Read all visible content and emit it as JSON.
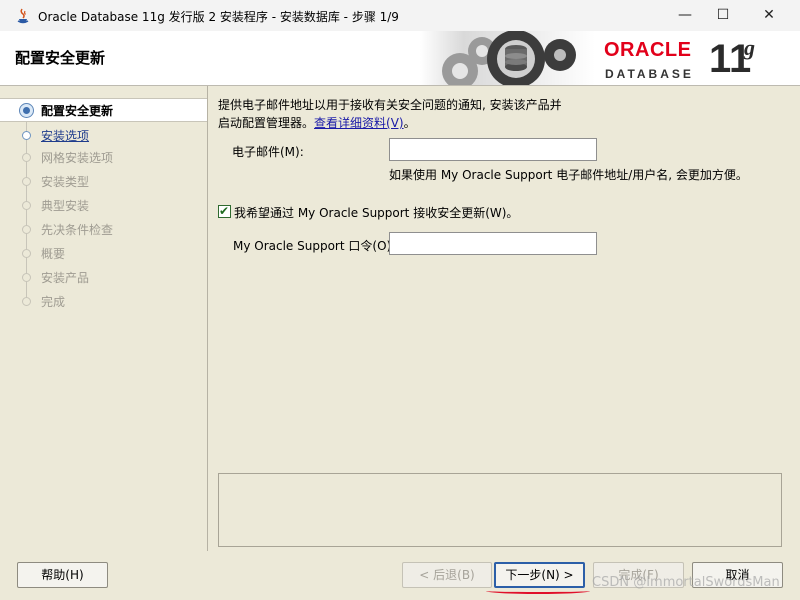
{
  "window": {
    "title": "Oracle Database 11g 发行版 2 安装程序 - 安装数据库 - 步骤 1/9",
    "controls": {
      "minimize": "—",
      "maximize": "☐",
      "close": "✕"
    }
  },
  "header": {
    "title": "配置安全更新",
    "brand": {
      "oracle": "ORACLE",
      "database": "DATABASE",
      "version": "11",
      "version_suffix": "g",
      "brand_color": "#e2001a"
    }
  },
  "sidebar": {
    "steps": [
      {
        "label": "配置安全更新",
        "state": "current"
      },
      {
        "label": "安装选项",
        "state": "link"
      },
      {
        "label": "网格安装选项",
        "state": "disabled"
      },
      {
        "label": "安装类型",
        "state": "disabled"
      },
      {
        "label": "典型安装",
        "state": "disabled"
      },
      {
        "label": "先决条件检查",
        "state": "disabled"
      },
      {
        "label": "概要",
        "state": "disabled"
      },
      {
        "label": "安装产品",
        "state": "disabled"
      },
      {
        "label": "完成",
        "state": "disabled"
      }
    ]
  },
  "main": {
    "intro_line1": "提供电子邮件地址以用于接收有关安全问题的通知, 安装该产品并",
    "intro_line2": "启动配置管理器。",
    "details_link": "查看详细资料(V)",
    "intro_end": "。",
    "email_label": "电子邮件(M):",
    "email_value": "",
    "email_hint": "如果使用 My Oracle Support 电子邮件地址/用户名, 会更加方便。",
    "checkbox_label": "我希望通过 My Oracle Support 接收安全更新(W)。",
    "checkbox_checked": true,
    "password_label": "My Oracle Support 口令(O):",
    "password_value": ""
  },
  "buttons": {
    "help": "帮助(H)",
    "back": "< 后退(B)",
    "next": "下一步(N) >",
    "finish": "完成(F)",
    "cancel": "取消"
  },
  "watermark": "CSDN @ImmortalSwordsMan"
}
